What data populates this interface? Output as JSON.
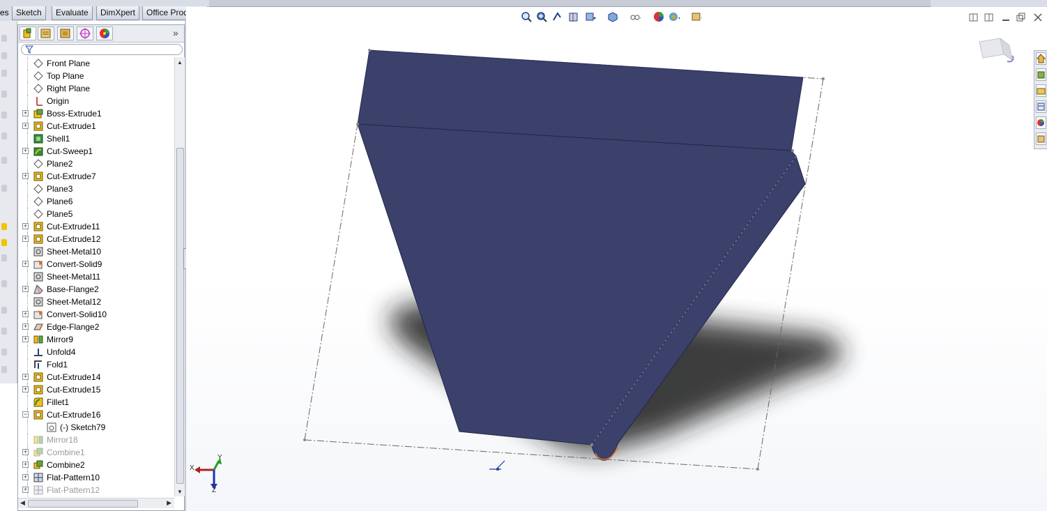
{
  "command_tabs": [
    "Sketch",
    "Evaluate",
    "DimXpert",
    "Office Products"
  ],
  "command_tabs_left_fragment": "es",
  "feature_tree": [
    {
      "label": "Front Plane",
      "icon": "plane-icon",
      "expander": false,
      "dim": false,
      "sub": false
    },
    {
      "label": "Top Plane",
      "icon": "plane-icon",
      "expander": false,
      "dim": false,
      "sub": false
    },
    {
      "label": "Right Plane",
      "icon": "plane-icon",
      "expander": false,
      "dim": false,
      "sub": false
    },
    {
      "label": "Origin",
      "icon": "origin-icon",
      "expander": false,
      "dim": false,
      "sub": false
    },
    {
      "label": "Boss-Extrude1",
      "icon": "extrude-icon",
      "expander": true,
      "dim": false,
      "sub": false
    },
    {
      "label": "Cut-Extrude1",
      "icon": "cut-extrude-icon",
      "expander": true,
      "dim": false,
      "sub": false
    },
    {
      "label": "Shell1",
      "icon": "shell-icon",
      "expander": false,
      "dim": false,
      "sub": false
    },
    {
      "label": "Cut-Sweep1",
      "icon": "cut-sweep-icon",
      "expander": true,
      "dim": false,
      "sub": false
    },
    {
      "label": "Plane2",
      "icon": "plane-icon",
      "expander": false,
      "dim": false,
      "sub": false
    },
    {
      "label": "Cut-Extrude7",
      "icon": "cut-extrude-icon",
      "expander": true,
      "dim": false,
      "sub": false
    },
    {
      "label": "Plane3",
      "icon": "plane-icon",
      "expander": false,
      "dim": false,
      "sub": false
    },
    {
      "label": "Plane6",
      "icon": "plane-icon",
      "expander": false,
      "dim": false,
      "sub": false
    },
    {
      "label": "Plane5",
      "icon": "plane-icon",
      "expander": false,
      "dim": false,
      "sub": false
    },
    {
      "label": "Cut-Extrude11",
      "icon": "cut-extrude-icon",
      "expander": true,
      "dim": false,
      "sub": false
    },
    {
      "label": "Cut-Extrude12",
      "icon": "cut-extrude-icon",
      "expander": true,
      "dim": false,
      "sub": false
    },
    {
      "label": "Sheet-Metal10",
      "icon": "sheet-metal-icon",
      "expander": false,
      "dim": false,
      "sub": false
    },
    {
      "label": "Convert-Solid9",
      "icon": "convert-solid-icon",
      "expander": true,
      "dim": false,
      "sub": false
    },
    {
      "label": "Sheet-Metal11",
      "icon": "sheet-metal-icon",
      "expander": false,
      "dim": false,
      "sub": false
    },
    {
      "label": "Base-Flange2",
      "icon": "base-flange-icon",
      "expander": true,
      "dim": false,
      "sub": false
    },
    {
      "label": "Sheet-Metal12",
      "icon": "sheet-metal-icon",
      "expander": false,
      "dim": false,
      "sub": false
    },
    {
      "label": "Convert-Solid10",
      "icon": "convert-solid-icon",
      "expander": true,
      "dim": false,
      "sub": false
    },
    {
      "label": "Edge-Flange2",
      "icon": "edge-flange-icon",
      "expander": true,
      "dim": false,
      "sub": false
    },
    {
      "label": "Mirror9",
      "icon": "mirror-icon",
      "expander": true,
      "dim": false,
      "sub": false
    },
    {
      "label": "Unfold4",
      "icon": "unfold-icon",
      "expander": false,
      "dim": false,
      "sub": false
    },
    {
      "label": "Fold1",
      "icon": "fold-icon",
      "expander": false,
      "dim": false,
      "sub": false
    },
    {
      "label": "Cut-Extrude14",
      "icon": "cut-extrude-icon",
      "expander": true,
      "dim": false,
      "sub": false
    },
    {
      "label": "Cut-Extrude15",
      "icon": "cut-extrude-icon",
      "expander": true,
      "dim": false,
      "sub": false
    },
    {
      "label": "Fillet1",
      "icon": "fillet-icon",
      "expander": false,
      "dim": false,
      "sub": false
    },
    {
      "label": "Cut-Extrude16",
      "icon": "cut-extrude-icon",
      "expander": true,
      "expanded": true,
      "dim": false,
      "sub": false
    },
    {
      "label": "(-) Sketch79",
      "icon": "sketch-icon",
      "expander": false,
      "dim": false,
      "sub": true
    },
    {
      "label": "Mirror18",
      "icon": "mirror-icon",
      "expander": false,
      "dim": true,
      "sub": false
    },
    {
      "label": "Combine1",
      "icon": "combine-icon",
      "expander": true,
      "dim": true,
      "sub": false
    },
    {
      "label": "Combine2",
      "icon": "combine-icon",
      "expander": true,
      "dim": false,
      "sub": false
    },
    {
      "label": "Flat-Pattern10",
      "icon": "flat-pattern-icon",
      "expander": true,
      "dim": false,
      "sub": false
    },
    {
      "label": "Flat-Pattern12",
      "icon": "flat-pattern-icon",
      "expander": true,
      "dim": true,
      "sub": false
    }
  ],
  "triad": {
    "x_label": "X",
    "y_label": "Y",
    "z_label": "Z"
  },
  "colors": {
    "part": "#3b416b",
    "part_edge": "#2a2f52",
    "shadow": "#1e1e1e",
    "viewport": "#ffffff"
  }
}
